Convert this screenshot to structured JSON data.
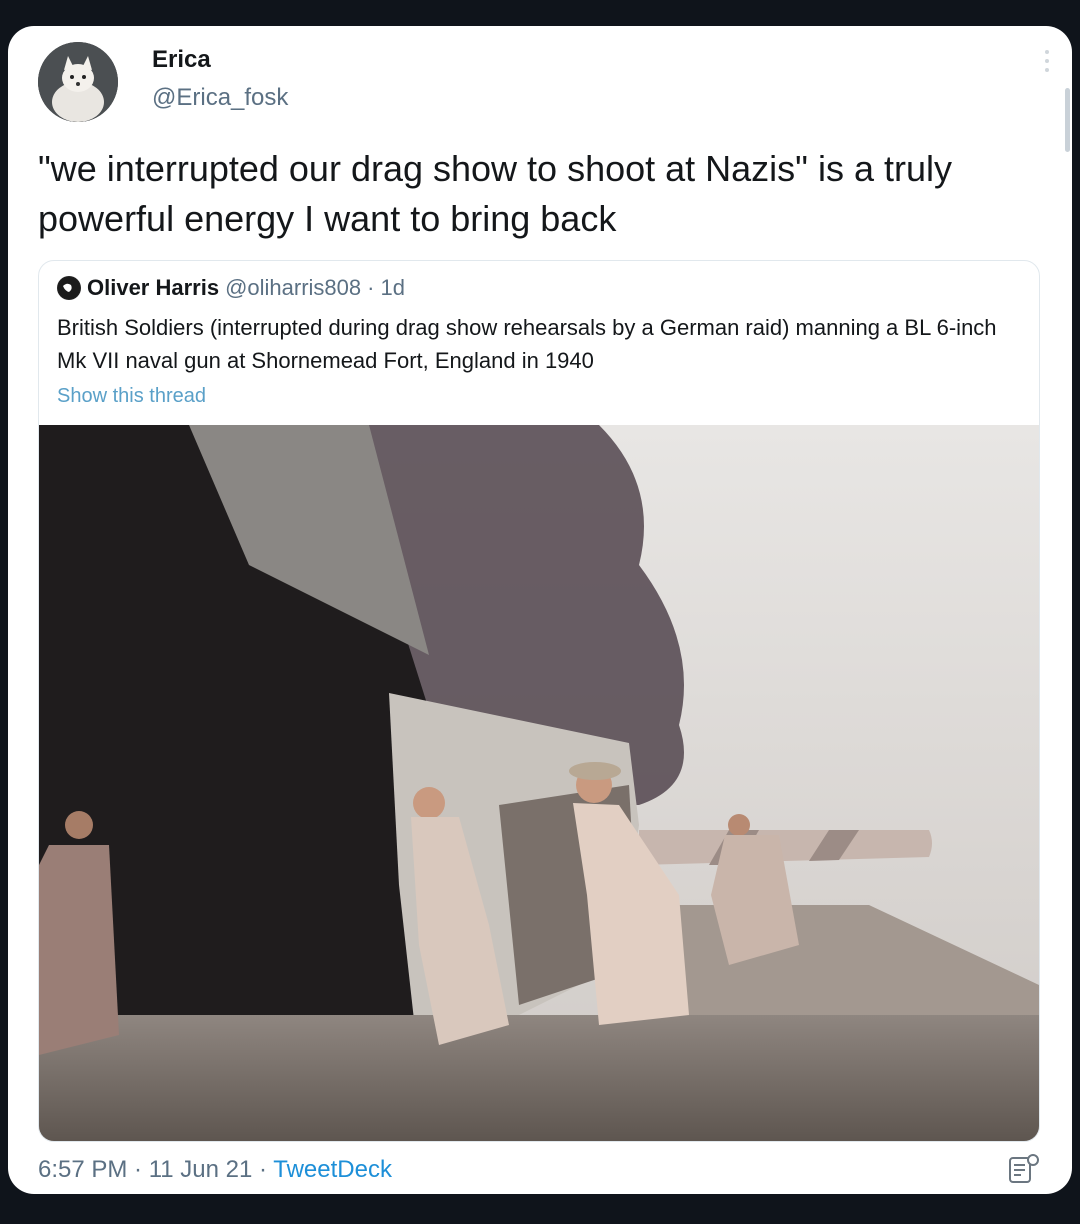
{
  "tweet": {
    "author_name": "Erica",
    "author_handle": "@Erica_fosk",
    "text": "\"we interrupted our drag show to shoot at Nazis\" is a truly powerful energy I want to bring back",
    "time": "6:57 PM",
    "date": "11 Jun 21",
    "separator": " · ",
    "source": "TweetDeck"
  },
  "quoted_tweet": {
    "author_name": "Oliver Harris",
    "author_handle": "@oliharris808",
    "age": "1d",
    "separator": " · ",
    "text": "British Soldiers (interrupted during drag show rehearsals by a German raid) manning a BL 6-inch Mk VII naval gun at Shornemead Fort, England in 1940",
    "link_text": "Show this thread"
  },
  "icons": {
    "avatar": "arctic-fox-avatar",
    "more": "more-vertical-icon",
    "app": "compose-icon"
  },
  "colors": {
    "background": "#0f141b",
    "card": "#ffffff",
    "link": "#1d8fd8",
    "muted": "#5b7083"
  }
}
